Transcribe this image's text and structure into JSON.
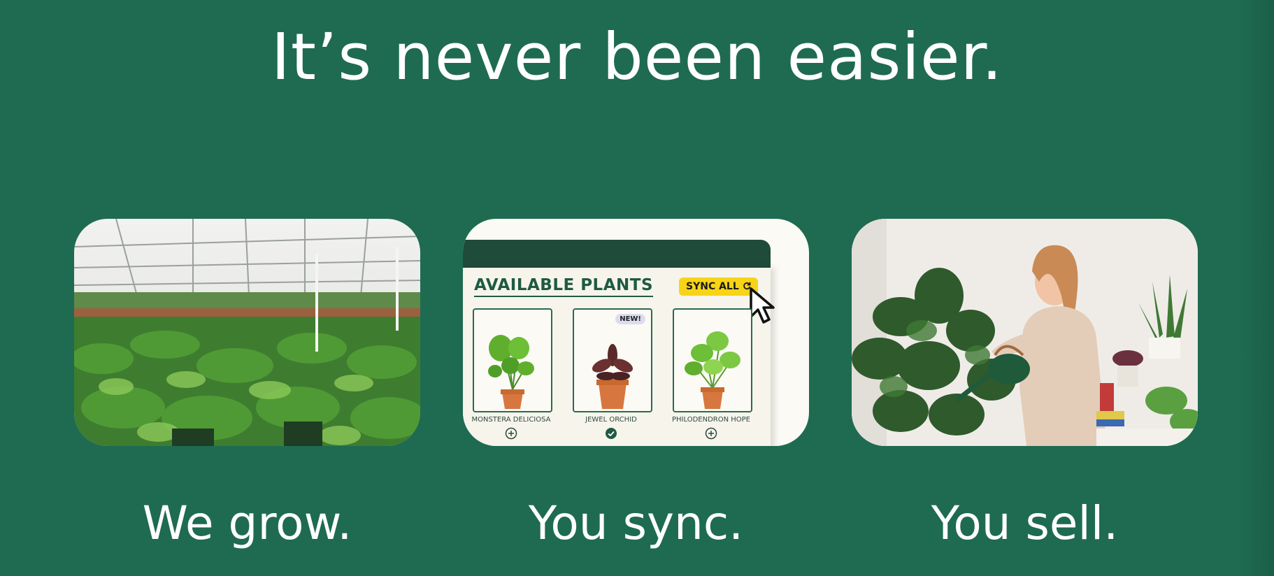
{
  "headline": "It’s never been easier.",
  "steps": [
    {
      "caption": "We grow.",
      "image": "greenhouse-plants-photo"
    },
    {
      "caption": "You sync.",
      "image": "app-mockup"
    },
    {
      "caption": "You sell.",
      "image": "woman-watering-plants-photo"
    }
  ],
  "mockup": {
    "title": "AVAILABLE PLANTS",
    "sync_label": "SYNC ALL",
    "plants": [
      {
        "name": "MONSTERA DELICIOSA",
        "action_icon": "plus-circle-icon"
      },
      {
        "name": "JEWEL ORCHID",
        "badge": "NEW!",
        "action_icon": "check-circle-icon"
      },
      {
        "name": "PHILODENDRON HOPE",
        "action_icon": "plus-circle-icon"
      }
    ]
  },
  "colors": {
    "background": "#1e6b51",
    "text": "#ffffff",
    "accent_yellow": "#f7d417",
    "dark_green": "#1f4b3a"
  }
}
